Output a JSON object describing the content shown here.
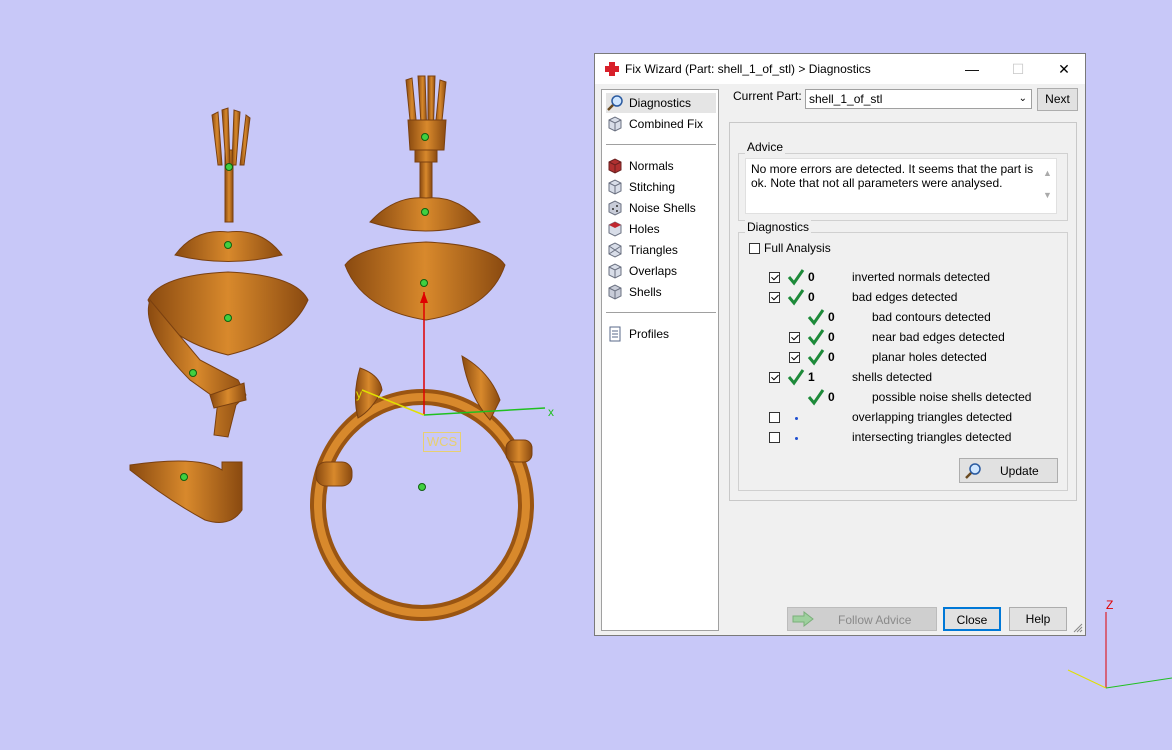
{
  "viewport": {
    "wcs_label": "WCS",
    "axis_x": "x",
    "axis_y": "y",
    "triad_z": "Z"
  },
  "dialog": {
    "title": "Fix Wizard (Part: shell_1_of_stl) > Diagnostics",
    "title_icon": "red-cross-icon",
    "controls": {
      "minimize": "—",
      "maximize": "☐",
      "close": "✕"
    },
    "nav_top": [
      {
        "label": "Diagnostics",
        "icon": "magnifier-icon",
        "active": true
      },
      {
        "label": "Combined Fix",
        "icon": "cube-icon"
      }
    ],
    "nav_tools": [
      {
        "label": "Normals",
        "icon": "normals-icon"
      },
      {
        "label": "Stitching",
        "icon": "stitching-icon"
      },
      {
        "label": "Noise Shells",
        "icon": "noise-shells-icon"
      },
      {
        "label": "Holes",
        "icon": "holes-icon"
      },
      {
        "label": "Triangles",
        "icon": "triangles-icon"
      },
      {
        "label": "Overlaps",
        "icon": "overlaps-icon"
      },
      {
        "label": "Shells",
        "icon": "shells-icon"
      }
    ],
    "nav_bottom": [
      {
        "label": "Profiles",
        "icon": "profiles-icon"
      }
    ],
    "current_part_label": "Current Part:",
    "current_part_value": "shell_1_of_stl",
    "next_button": "Next",
    "advice_title": "Advice",
    "advice_text": "No more errors are detected. It seems that the part is ok. Note that not all parameters were analysed.",
    "diagnostics_title": "Diagnostics",
    "full_analysis_label": "Full Analysis",
    "rows": [
      {
        "checkbox": true,
        "checked": true,
        "status": "ok",
        "count": "0",
        "label": "inverted normals detected",
        "level": 0
      },
      {
        "checkbox": true,
        "checked": true,
        "status": "ok",
        "count": "0",
        "label": "bad edges detected",
        "level": 0
      },
      {
        "checkbox": false,
        "checked": false,
        "status": "ok",
        "count": "0",
        "label": "bad contours detected",
        "level": 1
      },
      {
        "checkbox": true,
        "checked": true,
        "status": "ok",
        "count": "0",
        "label": "near bad edges detected",
        "level": 1
      },
      {
        "checkbox": true,
        "checked": true,
        "status": "ok",
        "count": "0",
        "label": "planar holes detected",
        "level": 1
      },
      {
        "checkbox": true,
        "checked": true,
        "status": "ok",
        "count": "1",
        "label": "shells detected",
        "level": 0
      },
      {
        "checkbox": false,
        "checked": false,
        "status": "ok",
        "count": "0",
        "label": "possible noise shells detected",
        "level": 1
      },
      {
        "checkbox": true,
        "checked": false,
        "status": "pending",
        "count": "",
        "label": "overlapping triangles detected",
        "level": 0
      },
      {
        "checkbox": true,
        "checked": false,
        "status": "pending",
        "count": "",
        "label": "intersecting triangles detected",
        "level": 0
      }
    ],
    "update_button": "Update",
    "follow_advice_button": "Follow Advice",
    "close_button": "Close",
    "help_button": "Help"
  },
  "colors": {
    "background": "#c8c8f8",
    "copper": "#c87820",
    "check_green": "#1e8a3a",
    "dot_blue": "#2050d0"
  }
}
